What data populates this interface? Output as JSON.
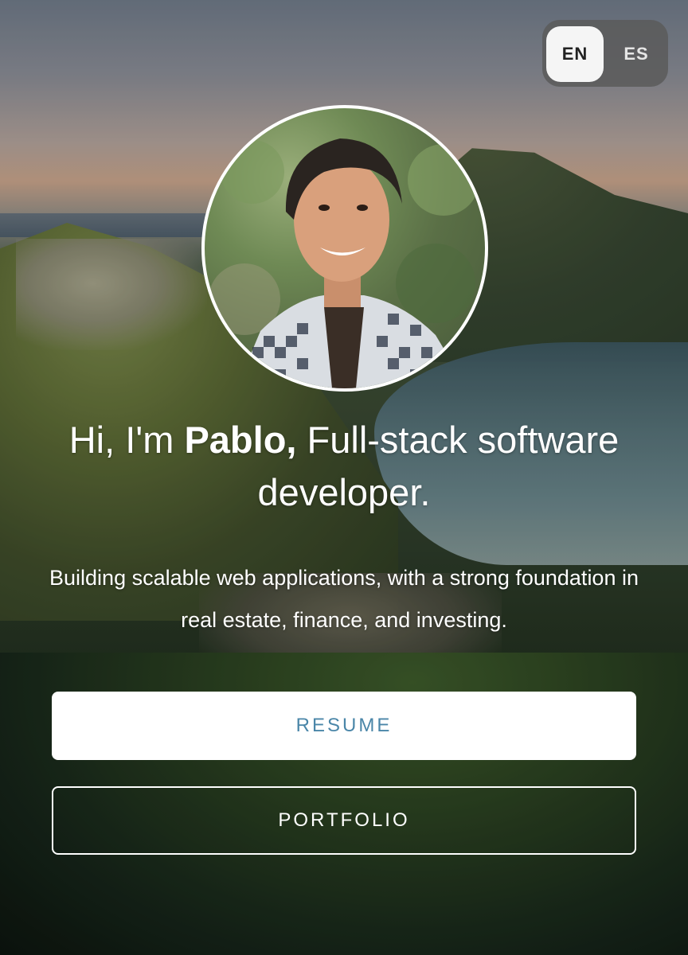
{
  "language_toggle": {
    "options": [
      {
        "label": "EN",
        "selected": true
      },
      {
        "label": "ES",
        "selected": false
      }
    ]
  },
  "avatar": {
    "alt": "Pablo"
  },
  "hero": {
    "greeting_prefix": "Hi, I'm ",
    "name": "Pablo,",
    "greeting_suffix": " Full-stack software developer.",
    "subtitle": "Building scalable web applications, with a strong foundation in real estate, finance, and investing."
  },
  "actions": {
    "resume_label": "RESUME",
    "portfolio_label": "PORTFOLIO"
  },
  "colors": {
    "accent": "#4a86a8",
    "button_bg": "#ffffff",
    "text": "#ffffff"
  }
}
